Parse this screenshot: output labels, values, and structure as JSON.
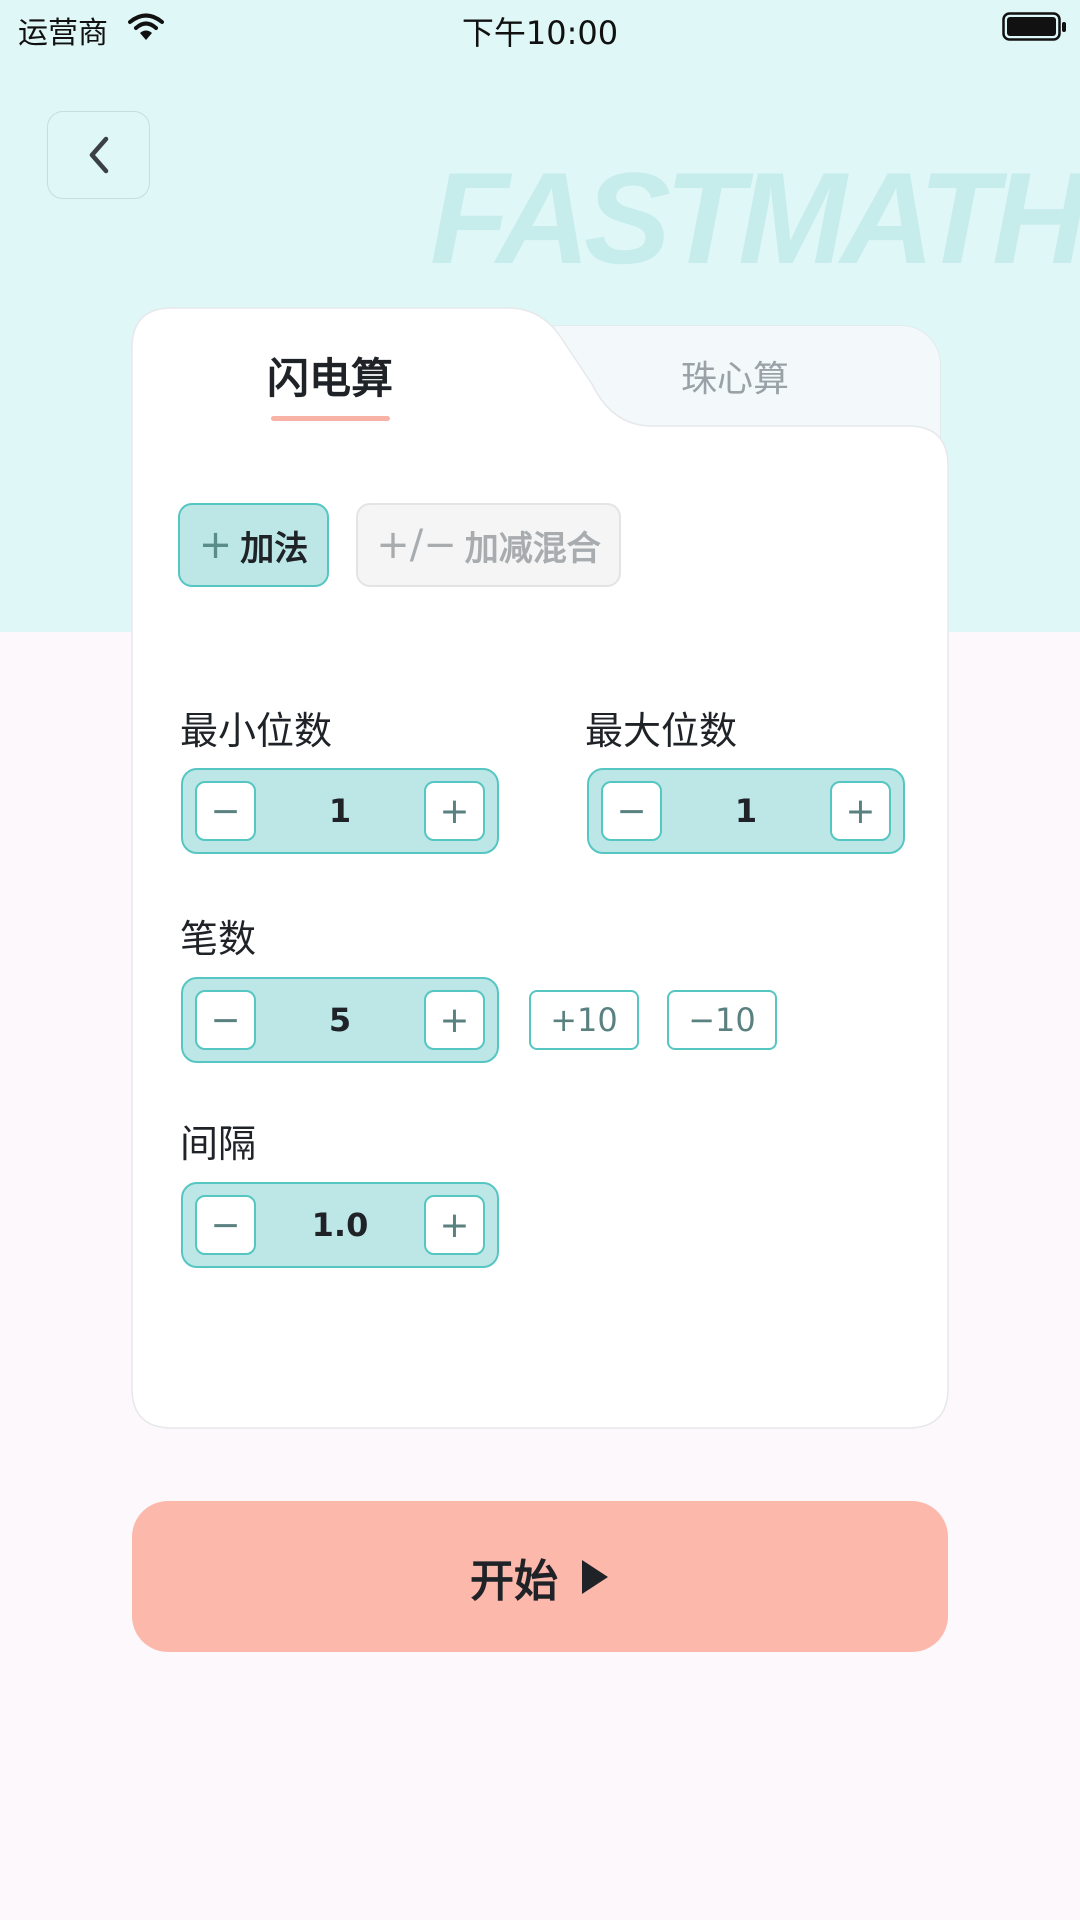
{
  "status_bar": {
    "carrier": "运营商",
    "time": "下午10:00"
  },
  "header": {
    "watermark": "FASTMATH"
  },
  "tabs": [
    {
      "label": "闪电算",
      "active": true
    },
    {
      "label": "珠心算",
      "active": false
    }
  ],
  "modes": {
    "add": {
      "symbol": "+",
      "label": "加法",
      "selected": true
    },
    "mixed": {
      "symbol": "+/−",
      "label": "加减混合",
      "selected": false
    }
  },
  "fields": {
    "min_digits": {
      "label": "最小位数",
      "value": "1"
    },
    "max_digits": {
      "label": "最大位数",
      "value": "1"
    },
    "strokes": {
      "label": "笔数",
      "value": "5",
      "quick_add": "+10",
      "quick_sub": "−10"
    },
    "interval": {
      "label": "间隔",
      "value": "1.0"
    }
  },
  "stepper_symbols": {
    "minus": "−",
    "plus": "+"
  },
  "start_button": {
    "label": "开始"
  },
  "colors": {
    "top_background": "#dff7f6",
    "page_background": "#fcf8fc",
    "accent": "#56c6c2",
    "accent_fill": "#bde6e6",
    "start_button": "#fcb8aa",
    "tab_underline": "#f8b2a6"
  }
}
